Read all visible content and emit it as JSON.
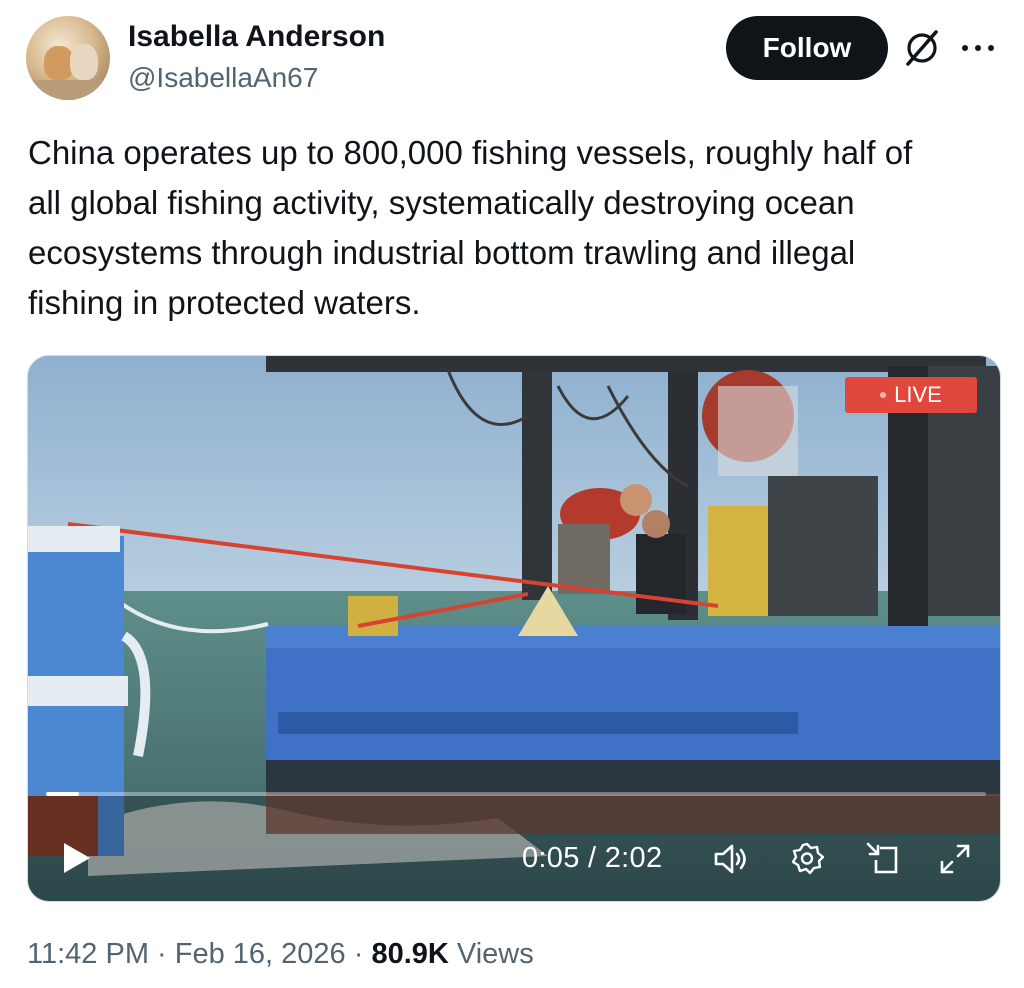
{
  "author": {
    "display_name": "Isabella Anderson",
    "handle": "@IsabellaAn67",
    "avatar_icon": "cats-photo-avatar"
  },
  "actions": {
    "follow_label": "Follow",
    "grok_icon": "grok-icon",
    "more_icon": "more-options-icon"
  },
  "tweet": {
    "text": "China operates up to 800,000 fishing vessels, roughly half of\nall global fishing activity, systematically destroying ocean\necosystems through industrial bottom trawling and illegal\nfishing in protected waters."
  },
  "video": {
    "live_label": "LIVE",
    "current_time": "0:05",
    "separator": " / ",
    "duration": "2:02",
    "progress_fraction": 0.035,
    "icons": [
      "play-icon",
      "volume-icon",
      "settings-gear-icon",
      "picture-in-picture-icon",
      "fullscreen-icon"
    ]
  },
  "footer": {
    "time": "11:42 PM",
    "dot": " · ",
    "date": "Feb 16, 2026",
    "views_count": "80.9K",
    "views_label": " Views"
  },
  "colors": {
    "follow_bg": "#0f1419",
    "live_bg": "#e0483d",
    "secondary_text": "#536471"
  }
}
